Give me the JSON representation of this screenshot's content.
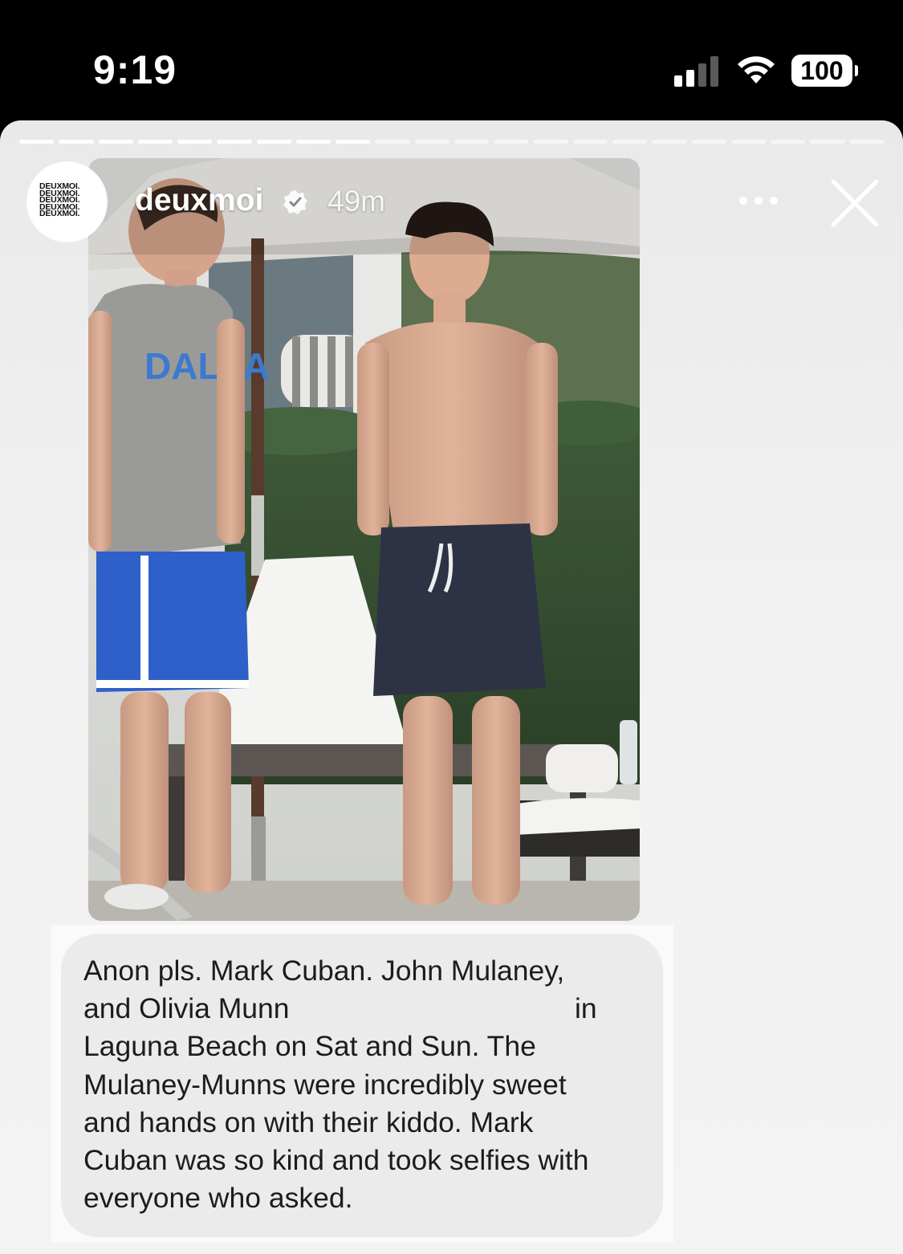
{
  "status_bar": {
    "time": "9:19",
    "battery": "100"
  },
  "story": {
    "segments_total": 22,
    "segments_done": 9,
    "avatar_lines": [
      "DEUXMOI.",
      "DEUXMOI.",
      "DEUXMOI.",
      "DEUXMOI.",
      "DEUXMOI."
    ],
    "username": "deuxmoi",
    "verified": true,
    "timestamp": "49m",
    "icons": {
      "more": "more-icon",
      "close": "close-icon",
      "verified": "verified-icon"
    }
  },
  "caption": {
    "lines": [
      "Anon pls. Mark Cuban. John Mulaney,",
      "and Olivia Munn",
      "in",
      "Laguna Beach on Sat and Sun. The",
      "Mulaney-Munns were incredibly sweet",
      "and hands on with their kiddo. Mark",
      "Cuban was so kind and took selfies with",
      "everyone who asked."
    ]
  },
  "colors": {
    "status_bg": "#000000",
    "sheet_bg": "#f1f1f1",
    "bubble_bg": "#ebebeb",
    "text": "#1c1c1c"
  }
}
